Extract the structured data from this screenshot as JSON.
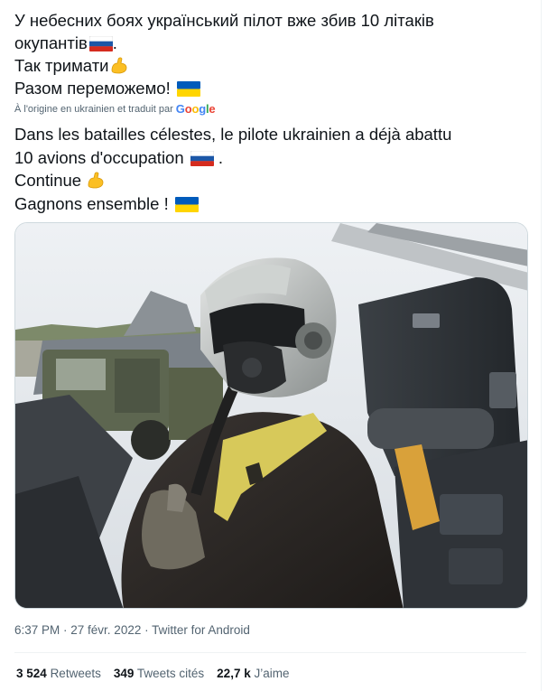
{
  "tweet": {
    "text_line1": "У небесних боях український пілот вже збив 10 літаків",
    "text_line2": "окупантів",
    "text_line2_suffix": ".",
    "text_line3": "Так тримати",
    "text_line4": "Разом переможемо!",
    "translated_by": "À l'origine en ukrainien et traduit par",
    "google_letters": [
      "G",
      "o",
      "o",
      "g",
      "l",
      "e"
    ],
    "tr_line1": "Dans les batailles célestes, le pilote ukrainien a déjà abattu",
    "tr_line2": "10 avions d'occupation",
    "tr_line2_suffix": " .",
    "tr_line3": " Continue",
    "tr_line4": " Gagnons ensemble !",
    "image_alt": "Ukrainian fighter pilot in cockpit wearing helmet and oxygen mask"
  },
  "meta": {
    "time": "6:37 PM",
    "sep1": " · ",
    "date": "27 févr. 2022",
    "sep2": " · ",
    "source": "Twitter for Android"
  },
  "stats": {
    "retweets_count": "3 524",
    "retweets_label": "Retweets",
    "quotes_count": "349",
    "quotes_label": "Tweets cités",
    "likes_count": "22,7 k",
    "likes_label": "J’aime"
  },
  "colors": {
    "text": "#0f1419",
    "secondary": "#536471",
    "border": "#eff3f4",
    "flag_white": "#ffffff",
    "flag_blue_ru": "#1c57a7",
    "flag_red_ru": "#d52b1e",
    "flag_blue_ua": "#005bbb",
    "flag_yellow_ua": "#ffd500"
  },
  "icons": [
    "russia-flag-icon",
    "ukraine-flag-icon",
    "flexed-biceps-icon",
    "google-logo"
  ]
}
